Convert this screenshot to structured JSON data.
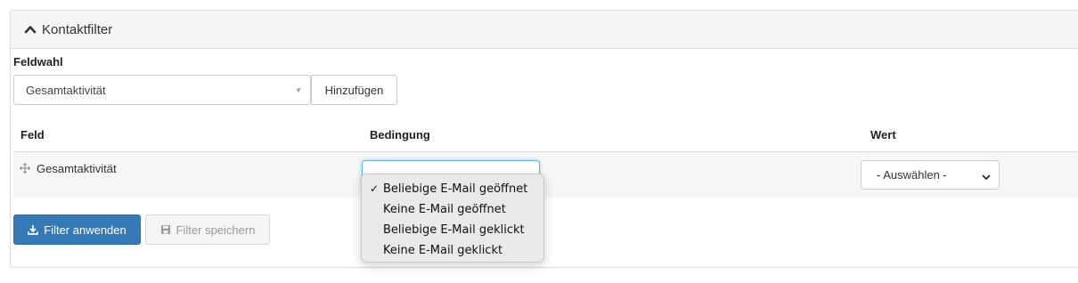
{
  "panel": {
    "title": "Kontaktfilter"
  },
  "field_selection": {
    "label": "Feldwahl",
    "selected_value": "Gesamtaktivität",
    "add_button": "Hinzufügen"
  },
  "table": {
    "columns": [
      "Feld",
      "Bedingung",
      "Wert"
    ],
    "rows": [
      {
        "field": "Gesamtaktivität",
        "value_select": "- Auswählen -"
      }
    ]
  },
  "condition_dropdown": {
    "selected": "Beliebige E-Mail geöffnet",
    "options": [
      "Beliebige E-Mail geöffnet",
      "Keine E-Mail geöffnet",
      "Beliebige E-Mail geklickt",
      "Keine E-Mail geklickt"
    ]
  },
  "actions": {
    "apply": "Filter anwenden",
    "save": "Filter speichern"
  },
  "colors": {
    "primary": "#337ab7",
    "panel_heading_bg": "#f5f5f5",
    "focus_border": "#66afe9"
  }
}
